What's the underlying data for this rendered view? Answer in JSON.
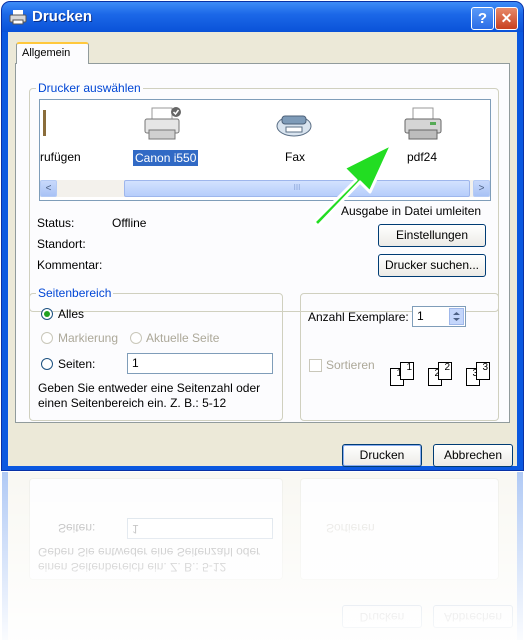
{
  "window": {
    "title": "Drucken"
  },
  "titlebar": {
    "help_label": "?",
    "close_label": "✕"
  },
  "tabs": [
    {
      "label": "Allgemein"
    }
  ],
  "printer_group": {
    "legend": "Drucker auswählen",
    "printers": [
      {
        "label": "rufügen",
        "icon": "add-printer-icon"
      },
      {
        "label": "Canon i550",
        "icon": "printer-icon",
        "selected": true
      },
      {
        "label": "Fax",
        "icon": "fax-icon"
      },
      {
        "label": "pdf24",
        "icon": "printer-icon"
      }
    ],
    "scroll_left": "<",
    "scroll_right": ">",
    "scroll_grip": "III"
  },
  "status": {
    "status_label": "Status:",
    "status_value": "Offline",
    "location_label": "Standort:",
    "comment_label": "Kommentar:"
  },
  "print_to_file_label": "Ausgabe in Datei umleiten",
  "buttons": {
    "settings": "Einstellungen",
    "find_printer": "Drucker suchen...",
    "print": "Drucken",
    "cancel": "Abbrechen"
  },
  "page_range": {
    "legend": "Seitenbereich",
    "all_label": "Alles",
    "selection_label": "Markierung",
    "current_page_label": "Aktuelle Seite",
    "pages_label": "Seiten:",
    "pages_value": "1",
    "hint_line1": "Geben Sie entweder eine Seitenzahl oder",
    "hint_line2": "einen Seitenbereich ein. Z. B.: 5-12"
  },
  "copies": {
    "label": "Anzahl Exemplare:",
    "value": "1",
    "collate_label": "Sortieren",
    "collate_pages": [
      "1",
      "1",
      "2",
      "2",
      "3",
      "3"
    ]
  },
  "colors": {
    "accent": "#0a58e0",
    "arrow": "#22dd22",
    "group_label": "#0046d5"
  }
}
